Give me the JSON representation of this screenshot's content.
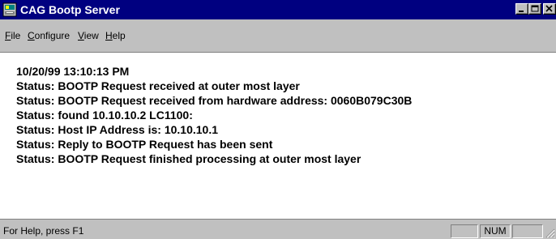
{
  "window": {
    "title": "CAG Bootp Server",
    "icon": "server-app-icon",
    "controls": [
      "minimize-icon",
      "maximize-icon",
      "close-icon"
    ]
  },
  "menu": {
    "items": [
      {
        "accel": "F",
        "rest": "ile"
      },
      {
        "accel": "C",
        "rest": "onfigure"
      },
      {
        "accel": "V",
        "rest": "iew"
      },
      {
        "accel": "H",
        "rest": "elp"
      }
    ]
  },
  "log": {
    "lines": [
      "10/20/99 13:10:13 PM",
      "Status: BOOTP Request received at outer most layer",
      "Status: BOOTP Request received from hardware address: 0060B079C30B",
      "Status: found 10.10.10.2 LC1100:",
      "Status: Host IP Address is: 10.10.10.1",
      "Status: Reply to BOOTP Request has been sent",
      "Status: BOOTP Request finished processing at outer most layer"
    ]
  },
  "statusbar": {
    "help_text": "For Help, press F1",
    "panes": [
      "",
      "NUM",
      ""
    ]
  },
  "colors": {
    "titlebar": "#000080",
    "face": "#c0c0c0",
    "client": "#ffffff"
  }
}
